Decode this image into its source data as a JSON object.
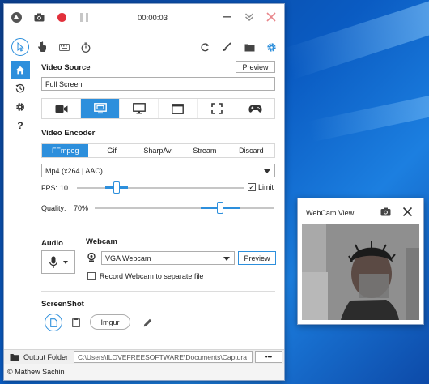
{
  "titlebar": {
    "timer": "00:00:03"
  },
  "video_source": {
    "heading": "Video Source",
    "preview_label": "Preview",
    "current_source": "Full Screen",
    "sources": [
      {
        "icon": "video-camera-icon"
      },
      {
        "icon": "monitor-select-icon",
        "active": true
      },
      {
        "icon": "monitor-icon"
      },
      {
        "icon": "window-icon"
      },
      {
        "icon": "region-icon"
      },
      {
        "icon": "gamepad-icon"
      }
    ]
  },
  "video_encoder": {
    "heading": "Video Encoder",
    "tabs": [
      "FFmpeg",
      "Gif",
      "SharpAvi",
      "Stream",
      "Discard"
    ],
    "active_tab": "FFmpeg",
    "codec": "Mp4 (x264 | AAC)",
    "fps_label": "FPS:",
    "fps_value": "10",
    "fps_level": 0.24,
    "limit_label": "Limit",
    "limit_checked": true,
    "quality_label": "Quality:",
    "quality_value": "70%",
    "quality_level": 0.7
  },
  "audio": {
    "heading": "Audio"
  },
  "webcam": {
    "heading": "Webcam",
    "device": "VGA Webcam",
    "preview_label": "Preview",
    "separate_file_label": "Record Webcam to separate file",
    "separate_file_checked": false
  },
  "screenshot": {
    "heading": "ScreenShot",
    "imgur_label": "Imgur"
  },
  "output": {
    "folder_label": "Output Folder",
    "path": "C:\\Users\\ILOVEFREESOFTWARE\\Documents\\Captura",
    "more_label": "•••"
  },
  "status": {
    "author": "© Mathew Sachin"
  },
  "webcam_view": {
    "title": "WebCam View"
  },
  "colors": {
    "accent": "#2d8fdc",
    "record": "#e2303b",
    "close": "#e8868b"
  }
}
